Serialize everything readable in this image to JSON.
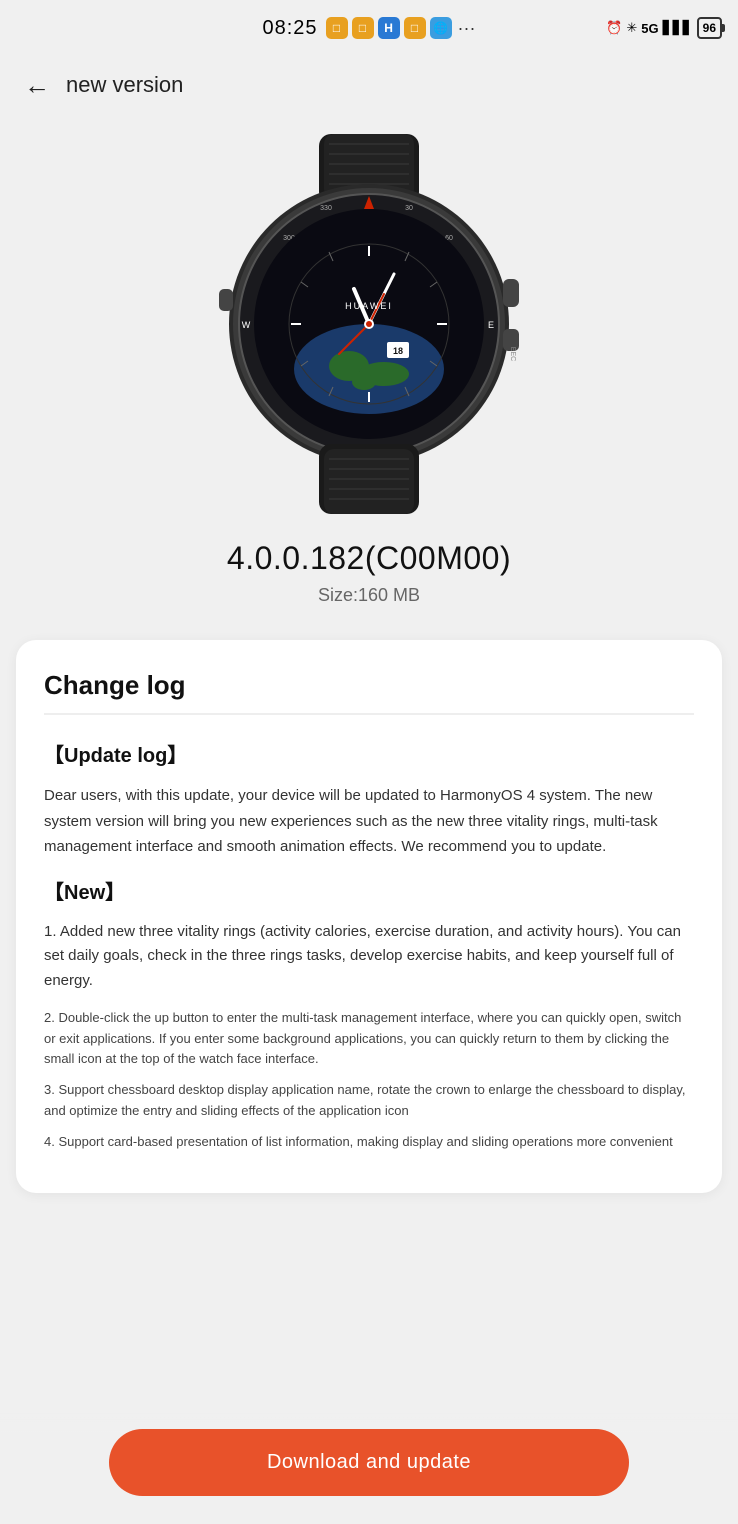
{
  "status_bar": {
    "time": "08:25",
    "battery": "96"
  },
  "header": {
    "back_label": "←",
    "title": "new version"
  },
  "version": {
    "number": "4.0.0.182(C00M00)",
    "size": "Size:160 MB"
  },
  "changelog": {
    "title": "Change log",
    "update_log_header": "【Update log】",
    "update_log_body": "Dear users, with this update, your device will be updated to HarmonyOS 4 system. The new system version will bring you new experiences such as the new three vitality rings, multi-task management interface and smooth animation effects. We recommend you to update.",
    "new_header": "【New】",
    "items": [
      "1. Added new three vitality rings (activity calories, exercise duration, and activity hours). You can set daily goals, check in the three rings tasks, develop exercise habits, and keep yourself full of energy.",
      "2. Double-click the up button to enter the multi-task management interface, where you can quickly open, switch or exit applications. If you enter some background applications, you can quickly return to them by clicking the small icon at the top of the watch face interface.",
      "3. Support chessboard desktop display application name, rotate the crown to enlarge the chessboard to display, and optimize the entry and sliding effects of the application icon",
      "4. Support card-based presentation of list information, making display and sliding operations more convenient"
    ]
  },
  "download_button": {
    "label": "Download and update"
  }
}
